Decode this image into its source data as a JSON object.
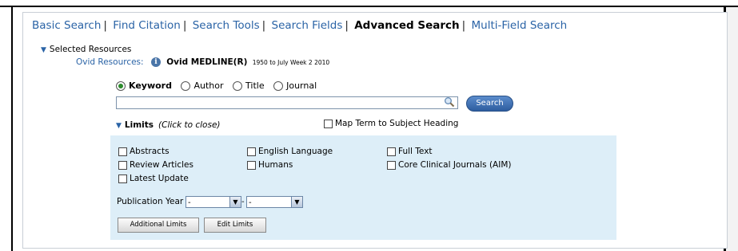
{
  "nav": {
    "items": [
      {
        "label": "Basic Search",
        "active": false
      },
      {
        "label": "Find Citation",
        "active": false
      },
      {
        "label": "Search Tools",
        "active": false
      },
      {
        "label": "Search Fields",
        "active": false
      },
      {
        "label": "Advanced Search",
        "active": true
      },
      {
        "label": "Multi-Field Search",
        "active": false
      }
    ],
    "separator": "|"
  },
  "resources": {
    "section_label": "Selected Resources",
    "ovid_label": "Ovid Resources:",
    "database_name": "Ovid MEDLINE(R)",
    "database_range": "1950 to July Week 2 2010"
  },
  "search": {
    "modes": [
      {
        "label": "Keyword",
        "checked": true
      },
      {
        "label": "Author",
        "checked": false
      },
      {
        "label": "Title",
        "checked": false
      },
      {
        "label": "Journal",
        "checked": false
      }
    ],
    "input_value": "",
    "button_label": "Search"
  },
  "limits": {
    "title": "Limits",
    "hint": "(Click to close)",
    "map_term_label": "Map Term to Subject Heading",
    "options": {
      "abstracts": "Abstracts",
      "review_articles": "Review Articles",
      "latest_update": "Latest Update",
      "english_language": "English Language",
      "humans": "Humans",
      "full_text": "Full Text",
      "core_clinical": "Core Clinical Journals (AIM)"
    },
    "pub_year_label": "Publication Year",
    "pub_year_from": "-",
    "pub_year_to": "-",
    "range_sep": "-",
    "additional_limits_label": "Additional Limits",
    "edit_limits_label": "Edit Limits"
  },
  "colors": {
    "link": "#2a63a6",
    "limits_bg": "#ddeef8",
    "search_button": "#2e5d9f"
  }
}
